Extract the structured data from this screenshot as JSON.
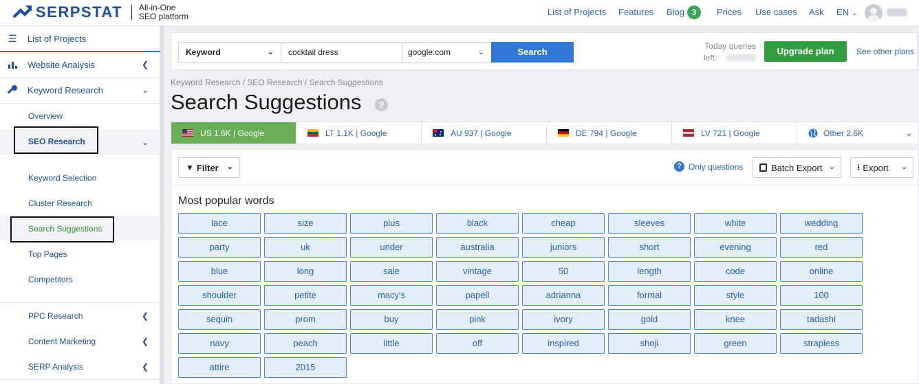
{
  "header": {
    "logo_text": "SERPSTAT",
    "tagline_line1": "All-in-One",
    "tagline_line2": "SEO platform",
    "nav": [
      "List of Projects",
      "Features",
      "Blog",
      "Prices",
      "Use cases",
      "Ask"
    ],
    "blog_count": "3",
    "lang": "EN"
  },
  "sidebar": {
    "top_items": [
      {
        "label": "List of Projects",
        "icon": "menu-icon"
      },
      {
        "label": "Website Analysis",
        "icon": "chart-icon"
      },
      {
        "label": "Keyword Research",
        "icon": "key-icon"
      }
    ],
    "keyword_sub": [
      "Overview",
      "SEO Research"
    ],
    "seo_sub": [
      "Keyword Selection",
      "Cluster Research",
      "Search Suggestions",
      "Top Pages",
      "Competitors"
    ],
    "bottom_items": [
      "PPC Research",
      "Content Marketing",
      "SERP Analysis"
    ]
  },
  "search": {
    "type_value": "Keyword",
    "query": "cocktail dress",
    "engine": "google.com",
    "search_label": "Search",
    "queries_label_1": "Today queries",
    "queries_label_2": "left:",
    "upgrade_label": "Upgrade plan",
    "other_plans": "See other plans"
  },
  "breadcrumb": "Keyword Research / SEO Research / Search Suggestions",
  "page_title": "Search Suggestions",
  "db_tabs": [
    {
      "label": "US 1.6K | Google",
      "flag": "us"
    },
    {
      "label": "LT 1.1K | Google",
      "flag": "lt"
    },
    {
      "label": "AU 937 | Google",
      "flag": "au"
    },
    {
      "label": "DE 794 | Google",
      "flag": "de"
    },
    {
      "label": "LV 721 | Google",
      "flag": "lv"
    },
    {
      "label": "Other 2.6K",
      "flag": "globe"
    }
  ],
  "toolbar": {
    "filter_label": "Filter",
    "only_questions": "Only questions",
    "batch_export": "Batch Export",
    "export": "Export"
  },
  "words_title": "Most popular words",
  "words": [
    "lace",
    "size",
    "plus",
    "black",
    "cheap",
    "sleeves",
    "white",
    "wedding",
    "party",
    "uk",
    "under",
    "australia",
    "juniors",
    "short",
    "evening",
    "red",
    "blue",
    "long",
    "sale",
    "vintage",
    "50",
    "length",
    "code",
    "online",
    "shoulder",
    "petite",
    "macy's",
    "papell",
    "adrianna",
    "formal",
    "style",
    "100",
    "sequin",
    "prom",
    "buy",
    "pink",
    "ivory",
    "gold",
    "knee",
    "tadashi",
    "navy",
    "peach",
    "little",
    "off",
    "inspired",
    "shoji",
    "green",
    "strapless",
    "attire",
    "2015"
  ]
}
